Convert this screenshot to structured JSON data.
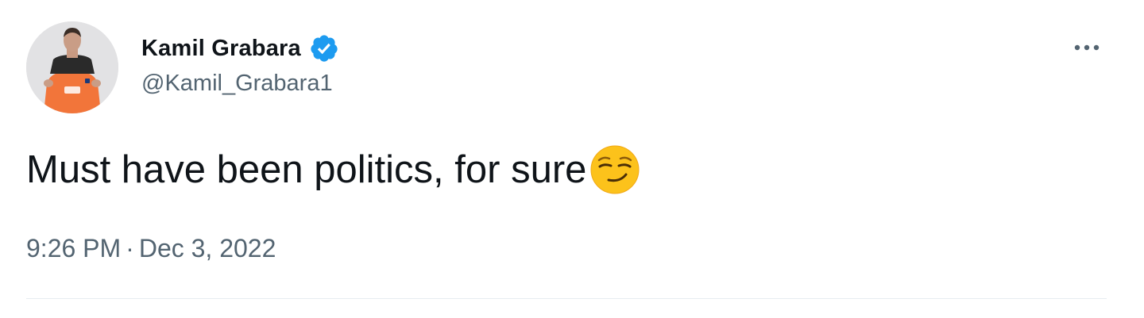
{
  "author": {
    "display_name": "Kamil Grabara",
    "handle": "@Kamil_Grabara1",
    "verified": true,
    "avatar_icon": "profile-photo-icon",
    "verified_color": "#1d9bf0"
  },
  "tweet": {
    "text": "Must have been politics, for sure",
    "emoji_icon": "smirking-face-icon",
    "time": "9:26 PM",
    "separator": "·",
    "date": "Dec 3, 2022"
  },
  "menu": {
    "more_icon": "more-options-icon"
  },
  "colors": {
    "text_primary": "#0f1419",
    "text_secondary": "#536471",
    "divider": "#e6ecf0"
  }
}
